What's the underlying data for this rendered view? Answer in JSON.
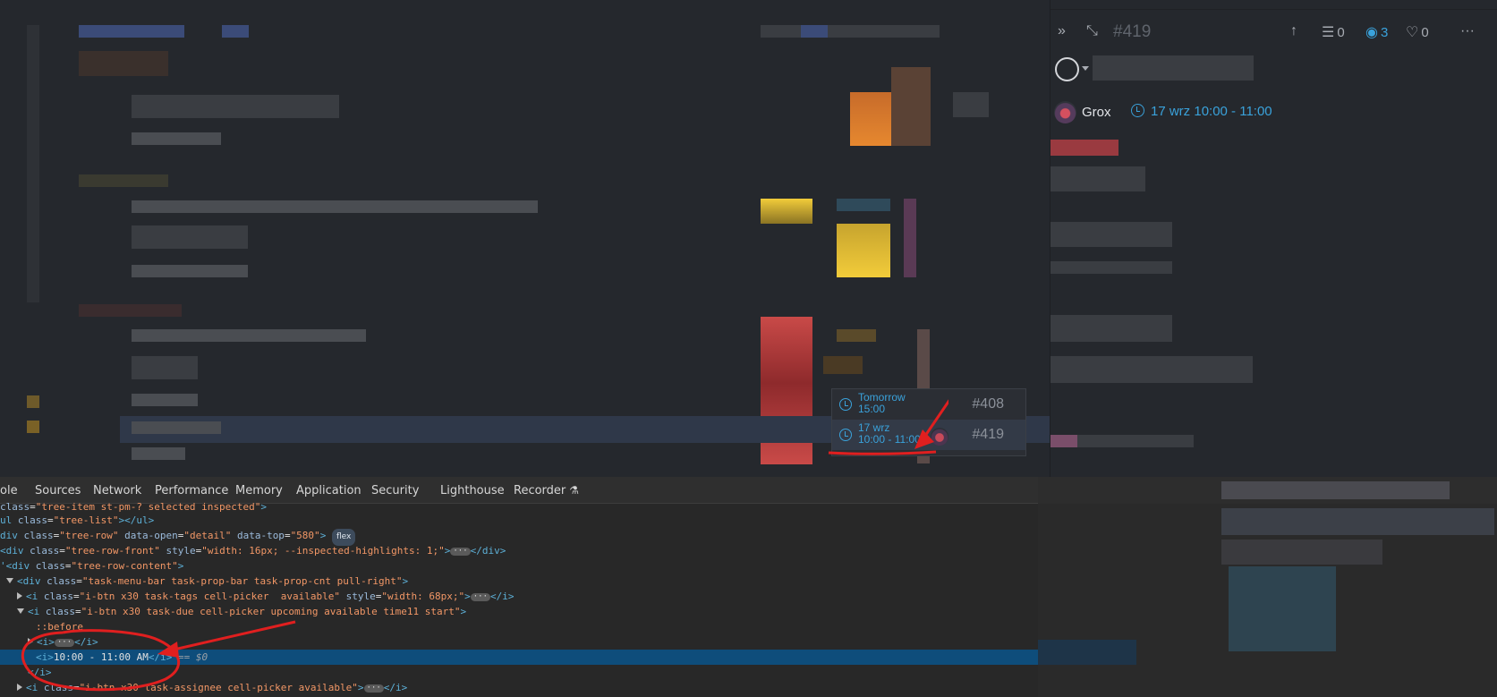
{
  "list": {
    "popup": {
      "rows": [
        {
          "due": "Tomorrow\n15:00",
          "id": "#408"
        },
        {
          "due": "17 wrz\n10:00 - 11:00",
          "id": "#419"
        }
      ]
    }
  },
  "detail": {
    "toolbar": {
      "task_id": "#419",
      "subtasks_count": "0",
      "watchers_count": "3",
      "likes_count": "0",
      "more": "···"
    },
    "assignee": "Grox",
    "due": "17 wrz 10:00 - 11:00",
    "colors": {
      "accent": "#3aa2db"
    }
  },
  "devtools": {
    "tabs": [
      "ole",
      "Sources",
      "Network",
      "Performance",
      "Memory",
      "Application",
      "Security",
      "Lighthouse",
      "Recorder"
    ],
    "selected_text": "10:00 - 11:00 AM",
    "selected_eq": " == $0"
  }
}
